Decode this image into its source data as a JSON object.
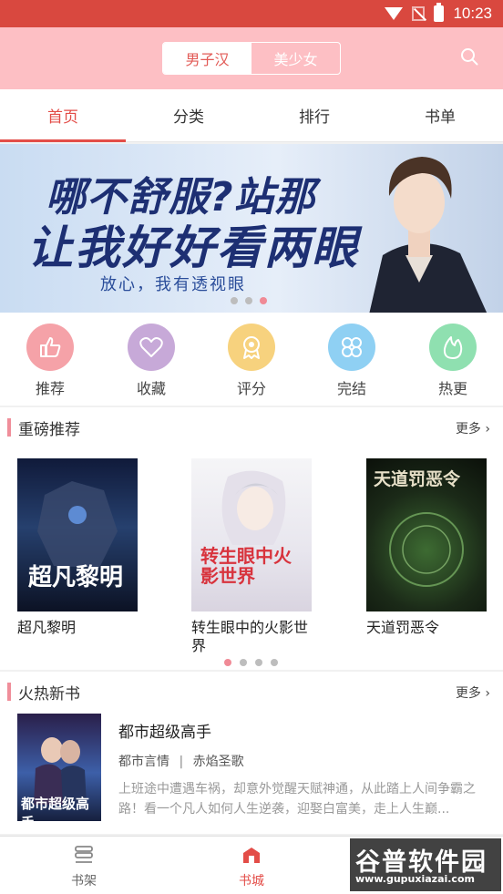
{
  "status_bar": {
    "time": "10:23"
  },
  "header": {
    "gender_tabs": [
      {
        "label": "男子汉",
        "active": true
      },
      {
        "label": "美少女",
        "active": false
      }
    ],
    "search_icon": "search-icon",
    "background": "#fdbfc4"
  },
  "nav_tabs": [
    {
      "label": "首页",
      "active": true
    },
    {
      "label": "分类",
      "active": false
    },
    {
      "label": "排行",
      "active": false
    },
    {
      "label": "书单",
      "active": false
    }
  ],
  "banner": {
    "headline_1": "哪不舒服?站那",
    "headline_2": "让我好好看两眼",
    "subline": "放心，我有透视眼",
    "slide_count": 3,
    "active_slide": 3
  },
  "categories": [
    {
      "label": "推荐",
      "icon": "thumbs-up-icon",
      "color": "#f5a2a8"
    },
    {
      "label": "收藏",
      "icon": "heart-icon",
      "color": "#c7a9d8"
    },
    {
      "label": "评分",
      "icon": "medal-icon",
      "color": "#f7d27e"
    },
    {
      "label": "完结",
      "icon": "clover-icon",
      "color": "#8fd0f3"
    },
    {
      "label": "热更",
      "icon": "flame-icon",
      "color": "#8fe0b0"
    }
  ],
  "featured": {
    "title": "重磅推荐",
    "more": "更多",
    "books": [
      {
        "title": "超凡黎明",
        "cover_text": "超凡黎明"
      },
      {
        "title": "转生眼中的火影世界",
        "cover_text": "转生眼中火影世界"
      },
      {
        "title": "天道罚恶令",
        "cover_text": "天道罚恶令"
      }
    ],
    "page_count": 4,
    "active_page": 1
  },
  "hot_new": {
    "title": "火热新书",
    "more": "更多",
    "book": {
      "title": "都市超级高手",
      "genre": "都市言情",
      "separator": "|",
      "author": "赤焰圣歌",
      "description": "上班途中遭遇车祸，却意外觉醒天赋神通，从此踏上人间争霸之路！看一个凡人如何人生逆袭，迎娶白富美，走上人生巅...",
      "cover_text": "都市超级高手"
    }
  },
  "bottom_nav": [
    {
      "label": "书架",
      "icon": "bookshelf-icon",
      "active": false
    },
    {
      "label": "书城",
      "icon": "bookstore-icon",
      "active": true
    }
  ],
  "watermark": {
    "main": "谷普软件园",
    "sub": "www.gupuxiazai.com"
  },
  "colors": {
    "accent": "#e34d48",
    "status_bar": "#d9483f",
    "pink_dot": "#f08a96"
  }
}
